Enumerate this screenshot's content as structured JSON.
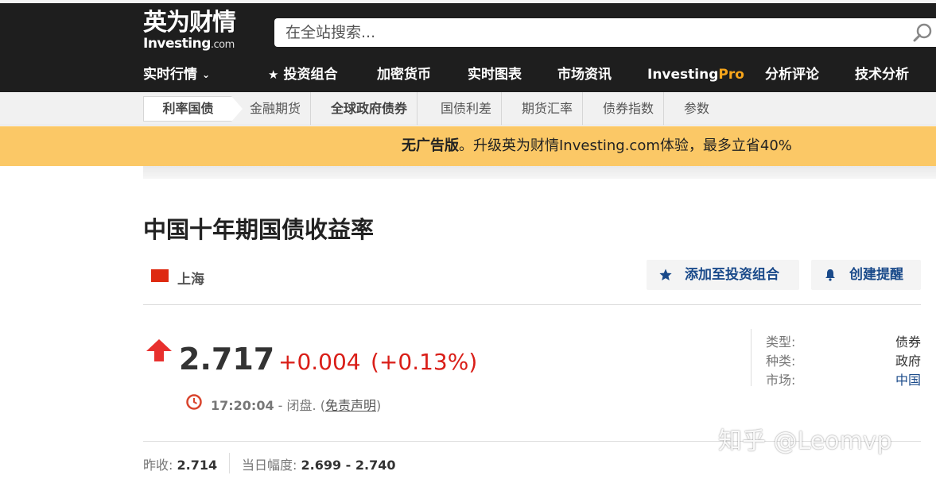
{
  "header": {
    "logo_cn": "英为财情",
    "logo_en": "Investing",
    "logo_en_suffix": ".com",
    "search_placeholder": "在全站搜索..."
  },
  "main_nav": {
    "items": [
      {
        "label": "实时行情"
      },
      {
        "label": "投资组合"
      },
      {
        "label": "加密货币"
      },
      {
        "label": "实时图表"
      },
      {
        "label": "市场资讯"
      },
      {
        "label_a": "Investing",
        "label_b": "Pro"
      },
      {
        "label": "分析评论"
      },
      {
        "label": "技术分析"
      }
    ]
  },
  "sub_nav": {
    "items": [
      {
        "label": "利率国债"
      },
      {
        "label": "金融期货"
      },
      {
        "label": "全球政府债券"
      },
      {
        "label": "国债利差"
      },
      {
        "label": "期货汇率"
      },
      {
        "label": "债券指数"
      },
      {
        "label": "参数"
      }
    ]
  },
  "banner": {
    "strong": "无广告版",
    "text": "。升级英为财情Investing.com体验，最多立省40%"
  },
  "instrument": {
    "title": "中国十年期国债收益率",
    "location": "上海",
    "flag_color": "#de2910",
    "add_portfolio": "添加至投资组合",
    "create_alert": "创建提醒"
  },
  "quote": {
    "price": "2.717",
    "change": "+0.004",
    "change_pct": "(+0.13%)",
    "time": "17:20:04",
    "status": " - 闭盘. (",
    "disclaimer": "免责声明",
    "close_paren": ")",
    "up_color": "#d91e18"
  },
  "info": {
    "rows": [
      {
        "label": "类型:",
        "value": "债券"
      },
      {
        "label": "种类:",
        "value": "政府"
      },
      {
        "label": "市场:",
        "value": "中国"
      }
    ]
  },
  "stats": {
    "prev_close_label": "昨收: ",
    "prev_close_value": "2.714",
    "day_range_label": "当日幅度: ",
    "day_range_value": "2.699 - 2.740"
  },
  "watermark": "知乎 @Leomvp"
}
